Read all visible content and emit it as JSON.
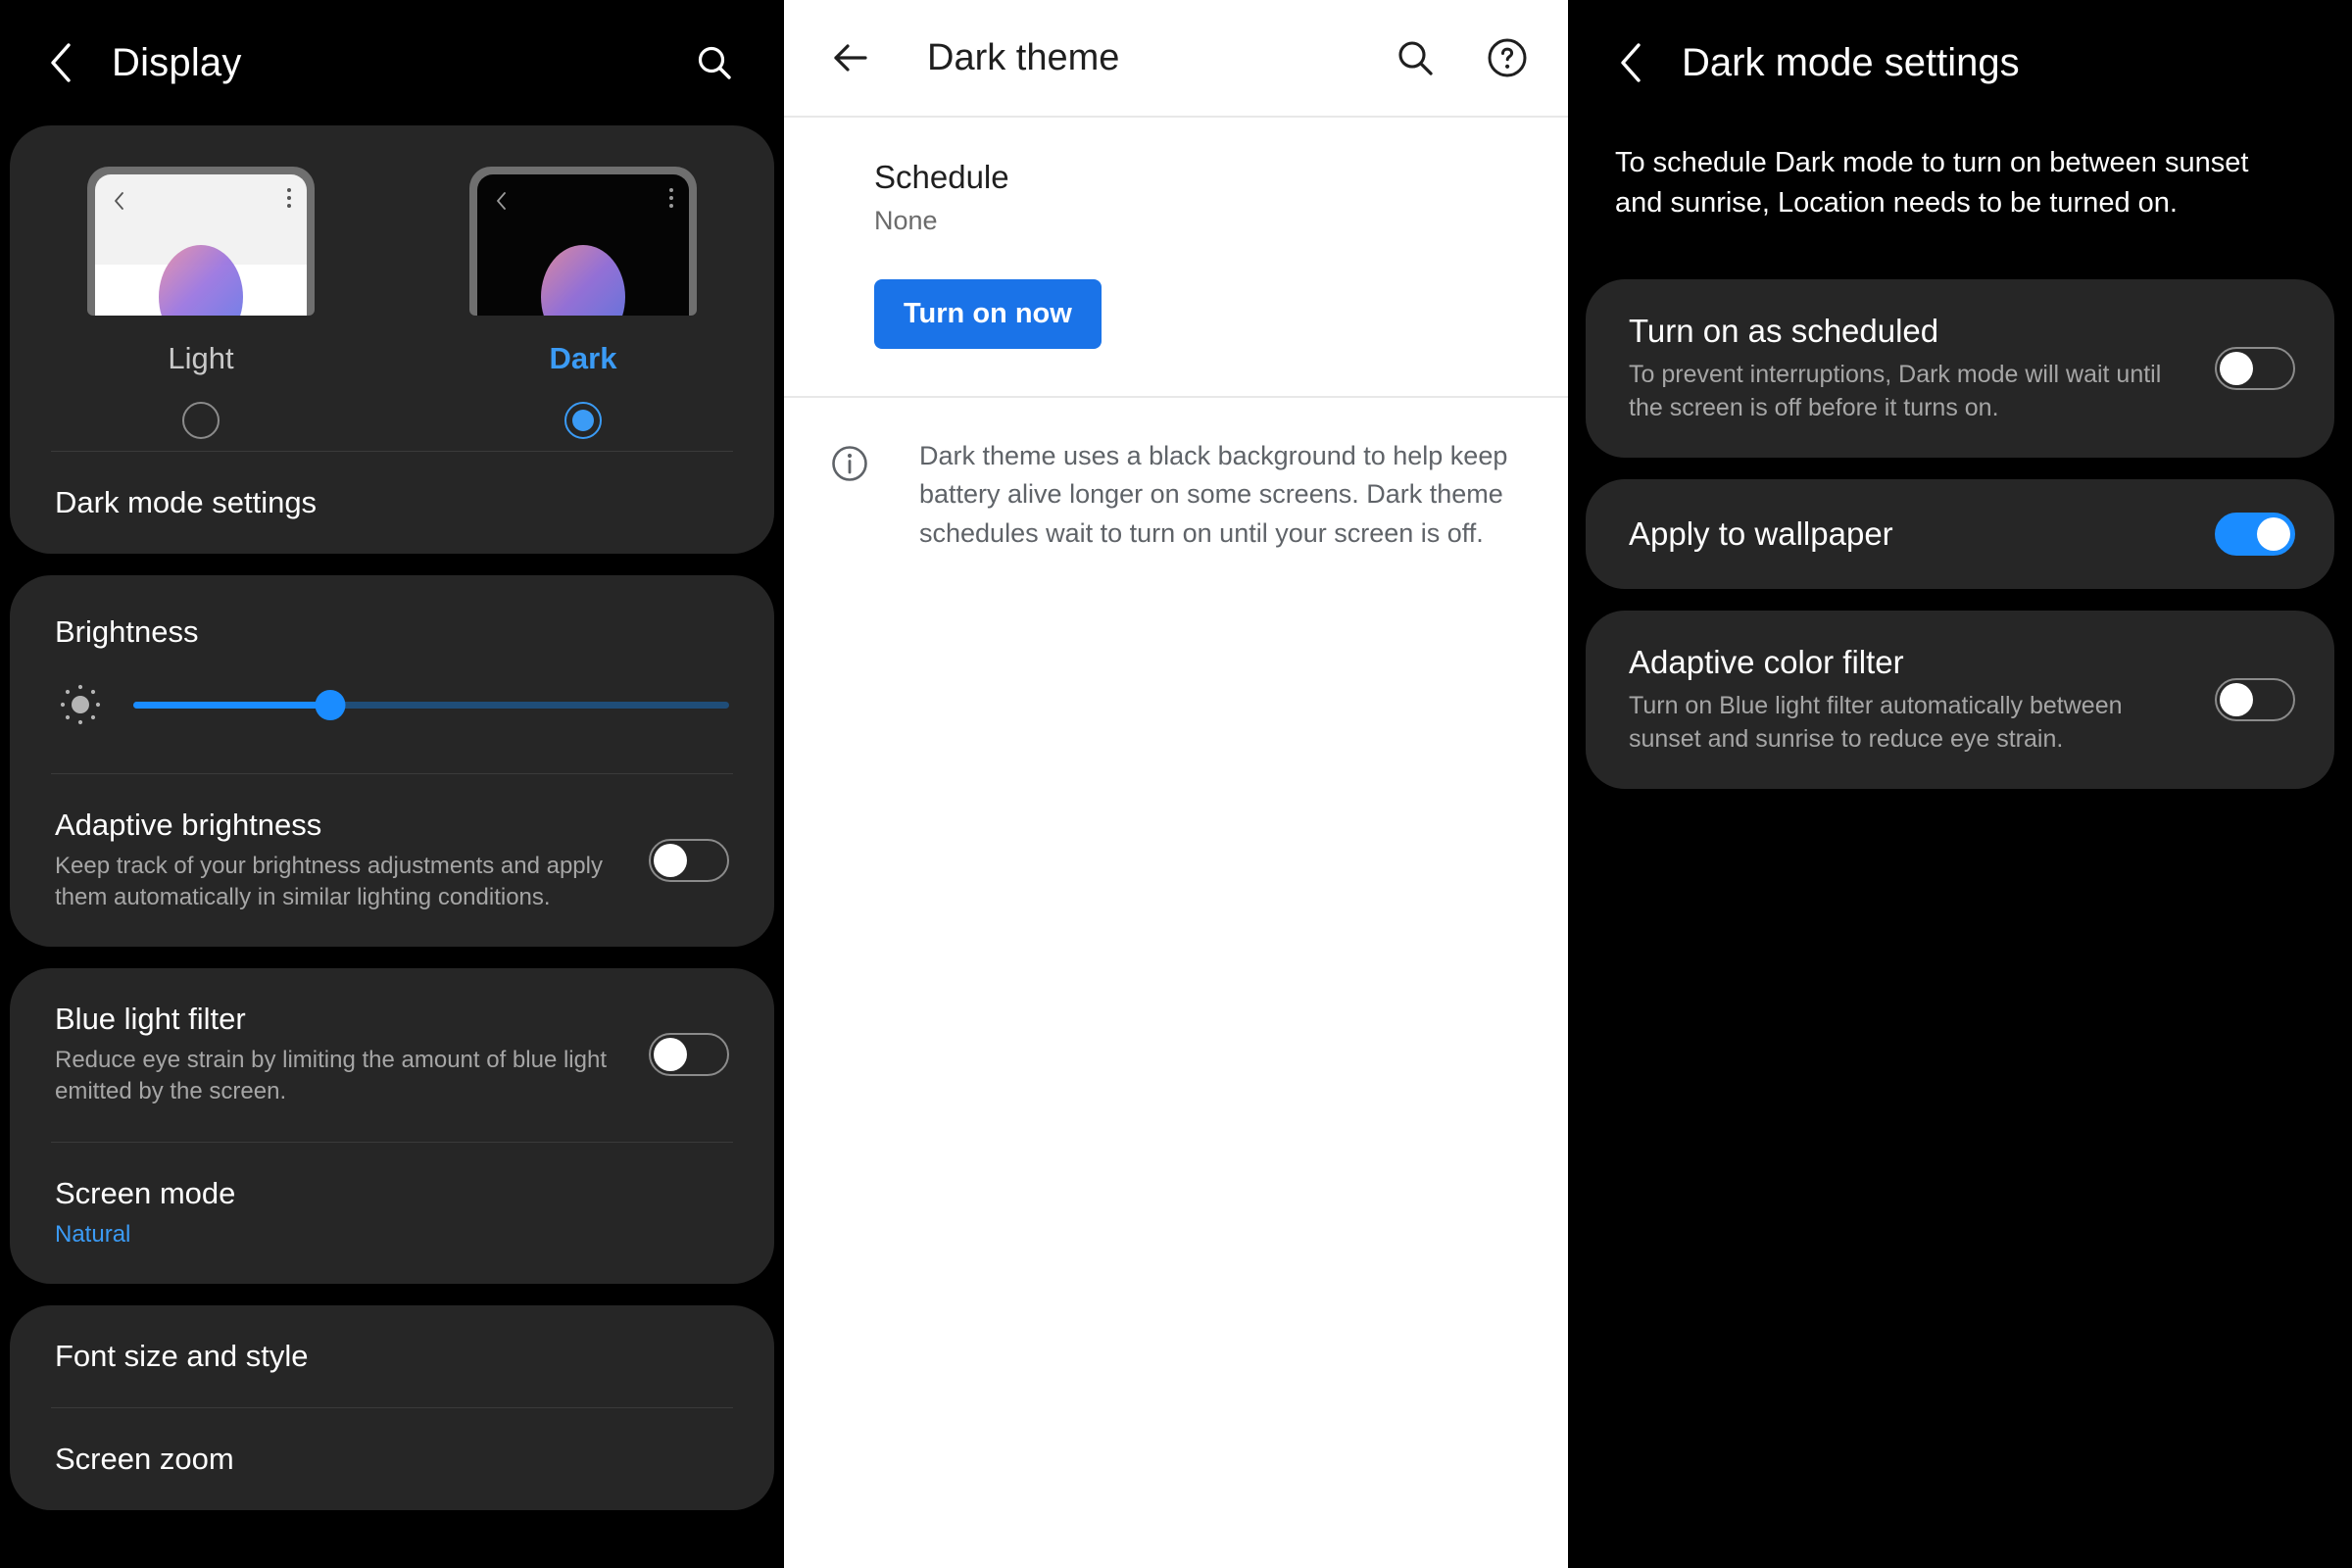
{
  "display_screen": {
    "appbar": {
      "title": "Display",
      "back_icon": "chevron-left-icon",
      "search_icon": "search-icon"
    },
    "theme_picker": {
      "light": {
        "label": "Light",
        "selected": false
      },
      "dark": {
        "label": "Dark",
        "selected": true
      },
      "selected_accent": "#3b9bf5"
    },
    "dark_mode_settings_row": {
      "label": "Dark mode settings"
    },
    "brightness": {
      "heading": "Brightness",
      "icon": "brightness-sun-icon",
      "value_percent": 33,
      "fill_color": "#1a8cff",
      "track_color": "#1f4d78"
    },
    "adaptive_brightness": {
      "title": "Adaptive brightness",
      "subtitle": "Keep track of your brightness adjustments and apply them automatically in similar lighting conditions.",
      "enabled": false
    },
    "blue_light_filter": {
      "title": "Blue light filter",
      "subtitle": "Reduce eye strain by limiting the amount of blue light emitted by the screen.",
      "enabled": false
    },
    "screen_mode": {
      "title": "Screen mode",
      "value": "Natural",
      "value_color": "#3b9bf5"
    },
    "font_size_and_style": {
      "label": "Font size and style"
    },
    "screen_zoom": {
      "label": "Screen zoom"
    }
  },
  "dark_theme_screen": {
    "appbar": {
      "title": "Dark theme",
      "back_icon": "arrow-left-icon",
      "search_icon": "search-icon",
      "help_icon": "help-circle-icon"
    },
    "schedule": {
      "title": "Schedule",
      "value": "None"
    },
    "turn_on_button": {
      "label": "Turn on now",
      "color": "#1a73e8"
    },
    "info": {
      "icon": "info-circle-icon",
      "text": "Dark theme uses a black background to help keep battery alive longer on some screens. Dark theme schedules wait to turn on until your screen is off."
    }
  },
  "dark_mode_settings_screen": {
    "appbar": {
      "title": "Dark mode settings",
      "back_icon": "chevron-left-icon"
    },
    "description": "To schedule Dark mode to turn on between sunset and sunrise, Location needs to be turned on.",
    "items": [
      {
        "title": "Turn on as scheduled",
        "subtitle": "To prevent interruptions, Dark mode will wait until the screen is off before it turns on.",
        "enabled": false
      },
      {
        "title": "Apply to wallpaper",
        "subtitle": "",
        "enabled": true
      },
      {
        "title": "Adaptive color filter",
        "subtitle": "Turn on Blue light filter automatically between sunset and sunrise to reduce eye strain.",
        "enabled": false
      }
    ],
    "toggle_on_color": "#1a8cff"
  }
}
